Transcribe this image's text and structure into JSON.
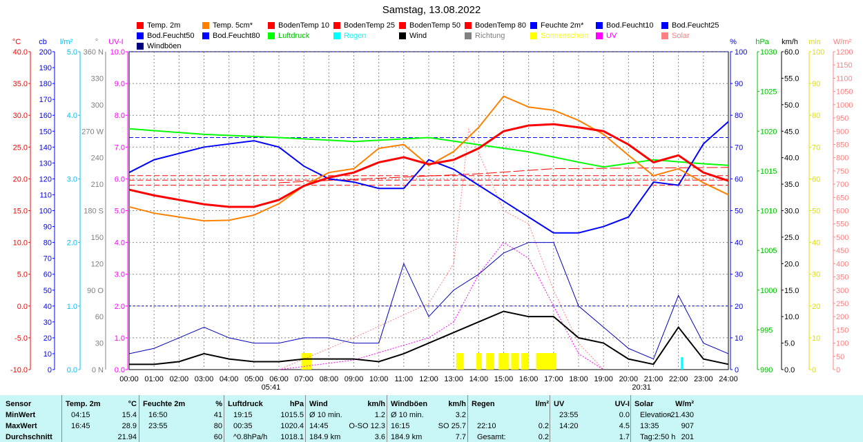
{
  "chart_data": {
    "type": "line",
    "title": "Samstag, 13.08.2022",
    "x_ticks": [
      "00:00",
      "01:00",
      "02:00",
      "03:00",
      "04:00",
      "05:00",
      "06:00",
      "07:00",
      "08:00",
      "09:00",
      "10:00",
      "11:00",
      "12:00",
      "13:00",
      "14:00",
      "15:00",
      "16:00",
      "17:00",
      "18:00",
      "19:00",
      "20:00",
      "21:00",
      "22:00",
      "23:00",
      "24:00"
    ],
    "sunrise": "05:41",
    "sunset": "20:31",
    "legend": [
      {
        "label": "Temp. 2m",
        "color": "#ff0000"
      },
      {
        "label": "Temp. 5cm*",
        "color": "#ff8000"
      },
      {
        "label": "BodenTemp 10",
        "color": "#ff0000"
      },
      {
        "label": "BodenTemp 25",
        "color": "#ff0000"
      },
      {
        "label": "BodenTemp 50",
        "color": "#ff0000"
      },
      {
        "label": "BodenTemp 80",
        "color": "#ff0000"
      },
      {
        "label": "Feuchte 2m*",
        "color": "#0000ff"
      },
      {
        "label": "Bod.Feucht10",
        "color": "#0000ff"
      },
      {
        "label": "Bod.Feucht25",
        "color": "#0000ff"
      },
      {
        "label": "Bod.Feucht50",
        "color": "#0000ff"
      },
      {
        "label": "Bod.Feucht80",
        "color": "#0000ff"
      },
      {
        "label": "Luftdruck",
        "color": "#00ff00"
      },
      {
        "label": "Regen",
        "color": "#00ffff"
      },
      {
        "label": "Wind",
        "color": "#000000"
      },
      {
        "label": "Richtung",
        "color": "#808080"
      },
      {
        "label": "Sonnenschein",
        "color": "#ffff00"
      },
      {
        "label": "UV",
        "color": "#ff00ff"
      },
      {
        "label": "Solar",
        "color": "#ff8080"
      },
      {
        "label": "Windböen",
        "color": "#000080"
      }
    ],
    "axes": {
      "temp": {
        "unit": "°C",
        "color": "#ff0000",
        "min": -10,
        "max": 40,
        "step": 5
      },
      "cb": {
        "unit": "cb",
        "color": "#0000ff",
        "min": 0,
        "max": 200,
        "step": 10
      },
      "rain": {
        "unit": "l/m²",
        "color": "#00c0ff",
        "min": 0,
        "max": 5,
        "step": 1
      },
      "dir": {
        "unit": "°",
        "color": "#808080",
        "labels": [
          "0 N",
          "30",
          "60",
          "90  O",
          "120",
          "150",
          "180 S",
          "210",
          "240",
          "270 W",
          "300",
          "330",
          "360 N"
        ]
      },
      "uv": {
        "unit": "UV-I",
        "color": "#ff00ff",
        "min": 0,
        "max": 10,
        "step": 1
      },
      "hum": {
        "unit": "%",
        "color": "#0000ff",
        "min": 0,
        "max": 100,
        "step": 10
      },
      "press": {
        "unit": "hPa",
        "color": "#00c000",
        "min": 990,
        "max": 1030,
        "step": 5
      },
      "wind": {
        "unit": "km/h",
        "color": "#000000",
        "min": 0,
        "max": 60,
        "step": 5
      },
      "sun": {
        "unit": "min",
        "color": "#e0e000",
        "min": 0,
        "max": 100,
        "step": 10
      },
      "solar": {
        "unit": "W/m²",
        "color": "#ff8080",
        "min": 0,
        "max": 1200,
        "step": 50
      }
    },
    "series": [
      {
        "name": "Temp. 2m",
        "axis": "temp",
        "color": "#ff0000",
        "width": 3,
        "hours": [
          0,
          1,
          2,
          3,
          4,
          5,
          6,
          7,
          8,
          9,
          10,
          11,
          12,
          13,
          14,
          15,
          16,
          17,
          18,
          19,
          20,
          21,
          22,
          23,
          24
        ],
        "values": [
          18.3,
          17.4,
          16.7,
          16.0,
          15.6,
          15.6,
          16.7,
          18.9,
          20.2,
          21.0,
          22.6,
          23.4,
          22.3,
          23.0,
          24.8,
          27.5,
          28.4,
          28.6,
          28.1,
          27.5,
          25.4,
          22.6,
          23.7,
          21.0,
          19.7
        ]
      },
      {
        "name": "Temp. 5cm*",
        "axis": "temp",
        "color": "#ff8000",
        "width": 2,
        "hours": [
          0,
          1,
          2,
          3,
          4,
          5,
          6,
          7,
          8,
          9,
          10,
          11,
          12,
          13,
          14,
          15,
          16,
          17,
          18,
          19,
          20,
          21,
          22,
          23,
          24
        ],
        "values": [
          15.6,
          14.6,
          14.0,
          13.4,
          13.5,
          14.3,
          16.1,
          18.9,
          21.0,
          21.6,
          24.8,
          25.4,
          22.1,
          24.3,
          28.1,
          33.0,
          31.3,
          30.8,
          29.2,
          27.0,
          23.7,
          20.5,
          21.6,
          19.4,
          17.5
        ]
      },
      {
        "name": "Feuchte 2m*",
        "axis": "hum",
        "color": "#0000ff",
        "width": 2,
        "hours": [
          0,
          1,
          2,
          3,
          4,
          5,
          6,
          7,
          8,
          9,
          10,
          11,
          12,
          13,
          14,
          15,
          16,
          17,
          18,
          19,
          20,
          21,
          22,
          23,
          24
        ],
        "values": [
          62,
          66,
          68,
          70,
          71,
          72,
          70,
          64,
          60,
          59,
          57,
          57,
          66,
          63,
          58,
          53,
          48,
          43,
          43,
          45,
          48,
          59,
          58,
          71,
          78
        ]
      },
      {
        "name": "Luftdruck",
        "axis": "press",
        "color": "#00ff00",
        "width": 2,
        "hours": [
          0,
          3,
          6,
          9,
          12,
          14,
          16,
          18,
          19,
          21,
          23,
          24
        ],
        "values": [
          1020.3,
          1019.6,
          1019.2,
          1018.7,
          1019.2,
          1018.3,
          1017.4,
          1016.1,
          1015.5,
          1016.4,
          1015.9,
          1015.7
        ]
      },
      {
        "name": "Windböen",
        "axis": "wind",
        "color": "#0000c0",
        "width": 1,
        "hours": [
          0,
          1,
          2,
          3,
          4,
          5,
          6,
          7,
          8,
          9,
          10,
          11,
          12,
          13,
          14,
          15,
          16,
          17,
          18,
          19,
          20,
          21,
          22,
          23,
          24
        ],
        "values": [
          3,
          4,
          6,
          8,
          6,
          5,
          5,
          6,
          6,
          5,
          5,
          20,
          10,
          15,
          18,
          22,
          24,
          24,
          12,
          8,
          4,
          2,
          14,
          5,
          3
        ]
      },
      {
        "name": "Wind",
        "axis": "wind",
        "color": "#000000",
        "width": 2,
        "hours": [
          0,
          1,
          2,
          3,
          4,
          5,
          6,
          7,
          8,
          9,
          10,
          11,
          12,
          13,
          14,
          15,
          16,
          17,
          18,
          19,
          20,
          21,
          22,
          23,
          24
        ],
        "values": [
          1,
          1,
          1.5,
          3,
          2,
          1.5,
          1.5,
          2,
          2,
          2,
          1.5,
          3,
          5,
          7,
          9,
          11,
          10,
          10,
          6,
          5,
          2,
          1,
          8,
          2,
          1
        ]
      },
      {
        "name": "UV",
        "axis": "uv",
        "color": "#ff00ff",
        "width": 1,
        "dash": "2,2",
        "hours": [
          6,
          9,
          12,
          13,
          14,
          15,
          16,
          17,
          18,
          19
        ],
        "values": [
          0,
          0.3,
          1,
          1.5,
          3,
          4,
          3.5,
          2,
          0.5,
          0
        ]
      },
      {
        "name": "Solar",
        "axis": "solar",
        "color": "#ff8080",
        "width": 1,
        "dash": "2,2",
        "hours": [
          6,
          9,
          12,
          13,
          13.6,
          15,
          16,
          17,
          18,
          19
        ],
        "values": [
          0,
          120,
          250,
          400,
          907,
          600,
          550,
          300,
          100,
          0
        ]
      },
      {
        "name": "BodenTemp 10",
        "axis": "temp",
        "color": "#ff0000",
        "width": 1,
        "dash": "8,4",
        "hours": [
          0,
          24
        ],
        "values": [
          20.5,
          20.5
        ]
      },
      {
        "name": "BodenTemp 25",
        "axis": "temp",
        "color": "#ff0000",
        "width": 1,
        "dash": "8,4",
        "hours": [
          0,
          24
        ],
        "values": [
          19.8,
          19.8
        ]
      },
      {
        "name": "BodenTemp 50",
        "axis": "temp",
        "color": "#ff0000",
        "width": 1,
        "dash": "8,4",
        "hours": [
          0,
          24
        ],
        "values": [
          19.0,
          19.0
        ]
      },
      {
        "name": "BodenTemp 80",
        "axis": "temp",
        "color": "#ff0000",
        "width": 1,
        "dash": "16,4",
        "hours": [
          6,
          14,
          17,
          24
        ],
        "values": [
          19.4,
          20.8,
          21.6,
          21.8
        ]
      },
      {
        "name": "Bod.Feucht10",
        "axis": "hum",
        "color": "#0000ff",
        "width": 1,
        "dash": "6,3",
        "hours": [
          0,
          24
        ],
        "values": [
          73,
          73
        ]
      },
      {
        "name": "Bod.Feucht25",
        "axis": "hum",
        "color": "#0000ff",
        "width": 1,
        "dash": "3,3",
        "hours": [
          0,
          24
        ],
        "values": [
          100,
          100
        ]
      },
      {
        "name": "Bod.Feucht50",
        "axis": "hum",
        "color": "#0000ff",
        "width": 1,
        "dash": "3,3",
        "hours": [
          0,
          24
        ],
        "values": [
          20,
          20
        ]
      }
    ],
    "sunshine_hours": [
      [
        6.9,
        7.3
      ],
      [
        13.1,
        13.4
      ],
      [
        13.9,
        14.1
      ],
      [
        14.3,
        14.6
      ],
      [
        14.8,
        15.2
      ],
      [
        15.3,
        15.6
      ],
      [
        15.7,
        16.0
      ],
      [
        16.3,
        17.1
      ]
    ],
    "rain_hours": [
      [
        22.1,
        22.15
      ]
    ]
  },
  "table": {
    "headers": [
      [
        "Sensor",
        ""
      ],
      [
        "Temp. 2m",
        "°C"
      ],
      [
        "Feuchte 2m",
        "%"
      ],
      [
        "Luftdruck",
        "hPa"
      ],
      [
        "Wind",
        "km/h"
      ],
      [
        "Windböen",
        "km/h"
      ],
      [
        "Regen",
        "l/m²"
      ],
      [
        "UV",
        "UV-I"
      ],
      [
        "Solar",
        "W/m²"
      ]
    ],
    "row_labels": [
      "MinWert",
      "MaxWert",
      "Durchschnitt"
    ],
    "rows": [
      [
        [
          "04:15",
          "15.4"
        ],
        [
          "16:50",
          "41"
        ],
        [
          "19:15",
          "1015.5"
        ],
        [
          "Ø 10 min.",
          "1.2"
        ],
        [
          "Ø 10 min.",
          "3.2"
        ],
        [
          "",
          ""
        ],
        [
          "23:55",
          "0.0"
        ],
        [
          "Elevation",
          "-21.430"
        ]
      ],
      [
        [
          "16:45",
          "28.9"
        ],
        [
          "23:55",
          "80"
        ],
        [
          "00:35",
          "1020.4"
        ],
        [
          "14:45",
          "O-SO 12.3"
        ],
        [
          "16:15",
          "SO 25.7"
        ],
        [
          "22:10",
          "0.2"
        ],
        [
          "14:20",
          "4.5"
        ],
        [
          "13:35",
          "907"
        ]
      ],
      [
        [
          "",
          "21.94"
        ],
        [
          "",
          "60"
        ],
        [
          "^0.8hPa/h",
          "1018.1"
        ],
        [
          "184.9 km",
          "3.6"
        ],
        [
          "184.9 km",
          "7.7"
        ],
        [
          "Gesamt:",
          "0.2"
        ],
        [
          "",
          "1.7"
        ],
        [
          "Tag:2:50 h",
          "201"
        ]
      ]
    ]
  }
}
